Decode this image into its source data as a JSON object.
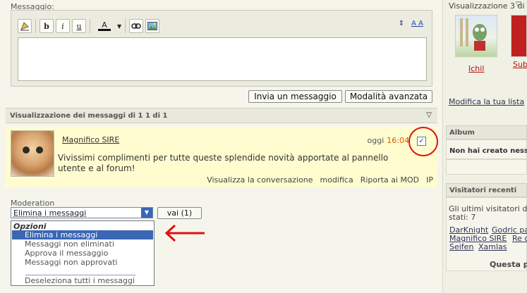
{
  "composer": {
    "label": "Messaggio:",
    "send_label": "Invia un messaggio",
    "advanced_label": "Modalità avanzata",
    "toolbar": {
      "bold": "b",
      "italic": "i",
      "underline": "u",
      "font_color": "A",
      "text_size": "A A",
      "resize": "⇕"
    }
  },
  "thread": {
    "header": "Visualizzazione dei messaggi di 1 1 di 1"
  },
  "post": {
    "username": "Magnifico SIRE",
    "date": "oggi",
    "time": "16:04",
    "checked": "✓",
    "body": "Vivissimi complimenti per tutte queste splendide novità apportate al pannello utente e al forum!",
    "actions": [
      "Visualizza la conversazione",
      "modifica",
      "Riporta ai MOD",
      "IP"
    ]
  },
  "moderation": {
    "label": "Moderation",
    "selected": "Elimina i messaggi",
    "go_label": "vai (1)",
    "group_label": "Opzioni",
    "options": [
      "Elimina i messaggi",
      "Messaggi non eliminati",
      "Approva il messaggio",
      "Messaggi non approvati",
      "Deseleziona tutti i messaggi"
    ]
  },
  "sidebar": {
    "friends_title": "Visualizzazione 3 di",
    "friend1": "Ichil",
    "friend2": "Sub",
    "edit_list": "Modifica la tua lista",
    "album_title": "Album",
    "album_empty": "Non hai creato ness",
    "visitors_title": "Visitatori recenti",
    "visitors_line1": "Gli ultimi visitatori d",
    "visitors_line2": "stati: 7",
    "visitors_row1_a": "DarKnight",
    "visitors_row1_b": "Godric pa",
    "visitors_row2_a": "Magnifico SIRE",
    "visitors_row2_b": "Re c",
    "visitors_row3_a": "Seifen",
    "visitors_row3_b": "Xamlas",
    "footer": "Questa pa"
  },
  "icons": {
    "accent": "#3a66b4",
    "highlight": "#e01010"
  }
}
